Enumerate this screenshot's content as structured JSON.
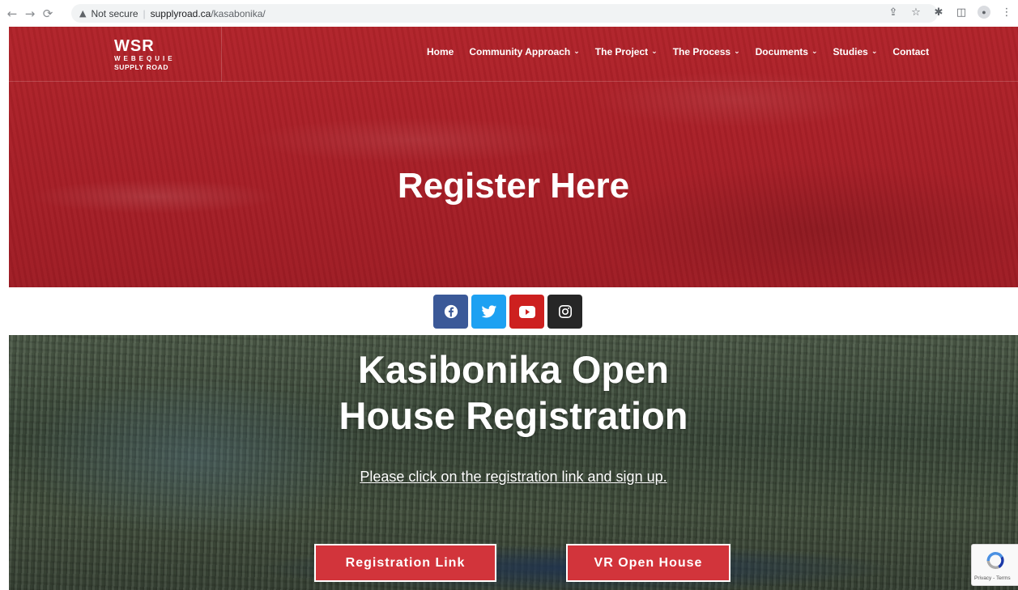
{
  "browser": {
    "back_icon": "arrow-left-icon",
    "forward_icon": "arrow-right-icon",
    "reload_icon": "reload-icon",
    "security_label": "Not secure",
    "url_host": "supplyroad.ca",
    "url_path": "/kasabonika/",
    "right_icons": [
      "share-icon",
      "star-icon",
      "extensions-icon",
      "sidepanel-icon",
      "profile-icon",
      "menu-icon"
    ]
  },
  "header": {
    "logo_title": "WSR",
    "logo_line1": "WEBEQUIE",
    "logo_line2": "SUPPLY ROAD",
    "nav": [
      {
        "label": "Home",
        "has_dropdown": false
      },
      {
        "label": "Community Approach",
        "has_dropdown": true
      },
      {
        "label": "The Project",
        "has_dropdown": true
      },
      {
        "label": "The Process",
        "has_dropdown": true
      },
      {
        "label": "Documents",
        "has_dropdown": true
      },
      {
        "label": "Studies",
        "has_dropdown": true
      },
      {
        "label": "Contact",
        "has_dropdown": false
      }
    ]
  },
  "hero": {
    "title": "Register Here",
    "color": "#a81f27"
  },
  "social": [
    "facebook-icon",
    "twitter-icon",
    "youtube-icon",
    "instagram-icon"
  ],
  "registration": {
    "title_line1": "Kasibonika Open",
    "title_line2": "House Registration",
    "subtitle": "Please click on the registration link and sign up.",
    "primary_button": "Registration Link",
    "secondary_button": "VR Open House",
    "button_color": "#d2343b"
  },
  "recaptcha": {
    "links": "Privacy - Terms"
  }
}
